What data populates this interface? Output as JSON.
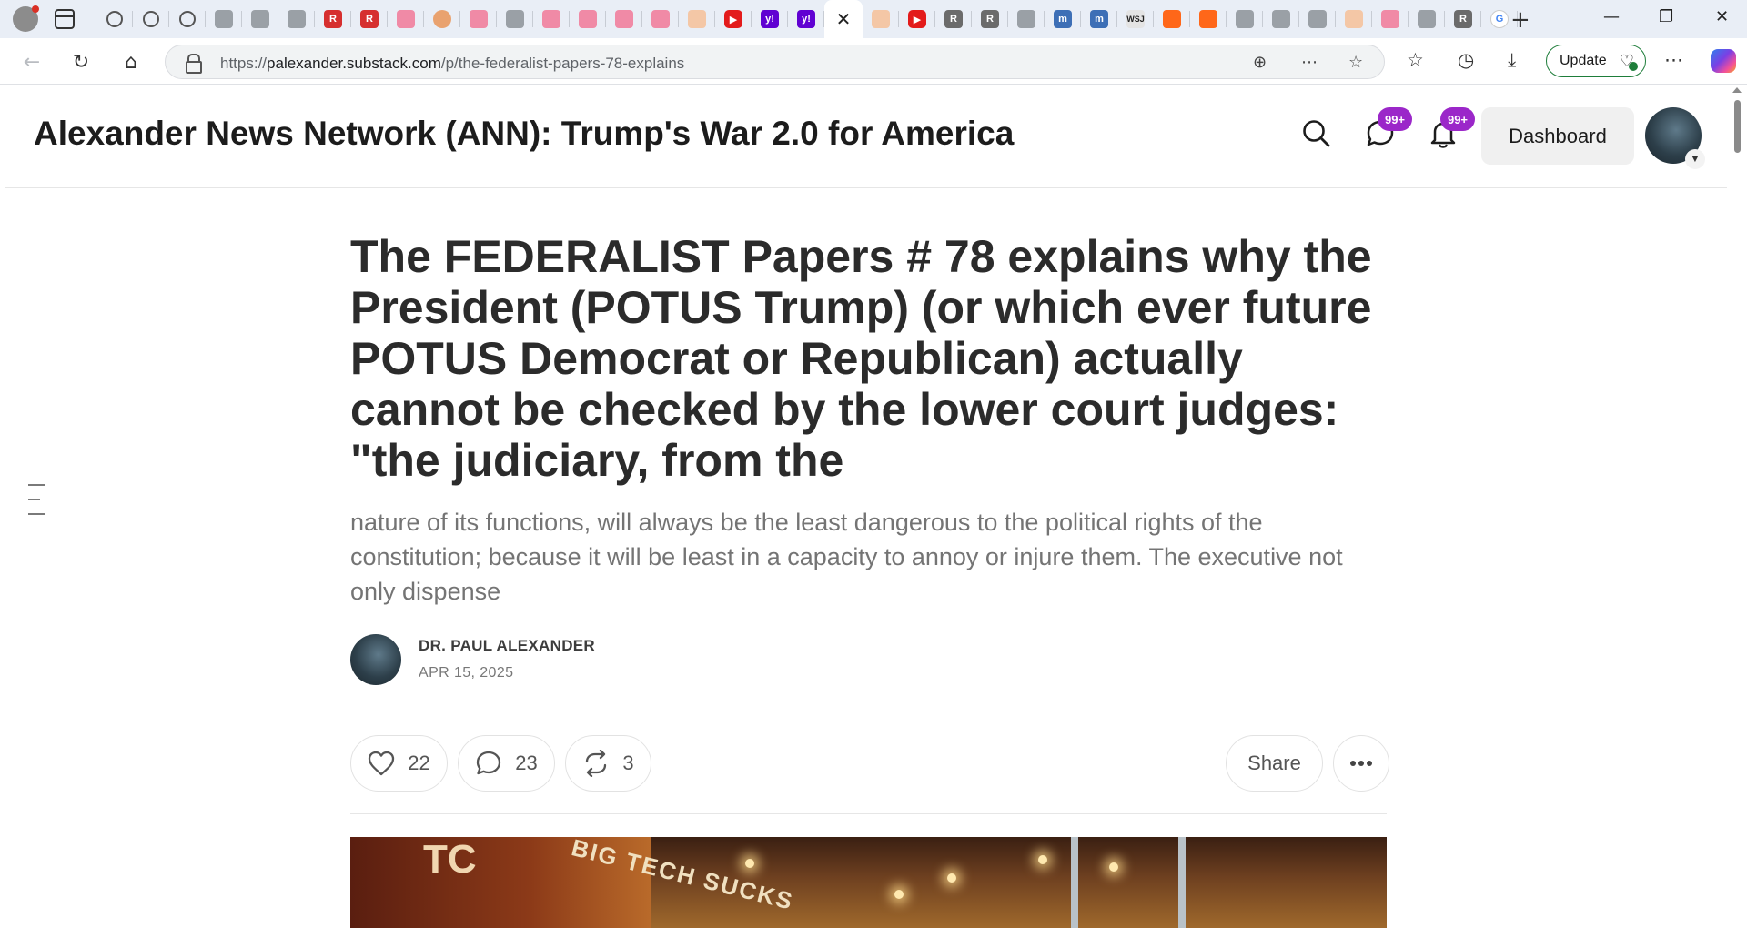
{
  "browser": {
    "url_prefix": "https://",
    "url_host": "palexander.substack.com",
    "url_path": "/p/the-federalist-papers-78-explains",
    "update_label": "Update",
    "tabs": [
      {
        "icon": "globe-icon",
        "style": "globe",
        "text": ""
      },
      {
        "icon": "globe-icon",
        "style": "globe",
        "text": ""
      },
      {
        "icon": "globe-icon",
        "style": "globe",
        "text": ""
      },
      {
        "icon": "fox-news-icon",
        "style": "gray",
        "text": ""
      },
      {
        "icon": "doc-icon",
        "style": "gray",
        "text": ""
      },
      {
        "icon": "arrow-icon",
        "style": "gray",
        "text": ""
      },
      {
        "icon": "r-icon",
        "style": "red",
        "text": "R"
      },
      {
        "icon": "r-icon",
        "style": "red",
        "text": "R"
      },
      {
        "icon": "pdf-icon",
        "style": "pink",
        "text": ""
      },
      {
        "icon": "circle-icon",
        "style": "orange",
        "text": ""
      },
      {
        "icon": "video-icon",
        "style": "pink",
        "text": ""
      },
      {
        "icon": "w-icon",
        "style": "gray",
        "text": ""
      },
      {
        "icon": "video-icon",
        "style": "pink",
        "text": ""
      },
      {
        "icon": "video-icon",
        "style": "pink",
        "text": ""
      },
      {
        "icon": "pdf-icon",
        "style": "pink",
        "text": ""
      },
      {
        "icon": "video-icon",
        "style": "pink",
        "text": ""
      },
      {
        "icon": "b-icon",
        "style": "peach",
        "text": ""
      },
      {
        "icon": "youtube-icon",
        "style": "yt",
        "text": "▶"
      },
      {
        "icon": "yahoo-icon",
        "style": "yahoo",
        "text": "y!"
      },
      {
        "icon": "yahoo-icon",
        "style": "yahoo",
        "text": "y!"
      },
      {
        "icon": "close-icon",
        "style": "active",
        "text": "✕"
      },
      {
        "icon": "substack-icon",
        "style": "peach",
        "text": ""
      },
      {
        "icon": "youtube-icon",
        "style": "yt",
        "text": "▶"
      },
      {
        "icon": "rk-icon",
        "style": "rk",
        "text": "R"
      },
      {
        "icon": "rk-icon",
        "style": "rk",
        "text": "R"
      },
      {
        "icon": "search-icon",
        "style": "gray",
        "text": ""
      },
      {
        "icon": "m-icon",
        "style": "m",
        "text": "m"
      },
      {
        "icon": "m-icon",
        "style": "m",
        "text": "m"
      },
      {
        "icon": "wsj-icon",
        "style": "wsj",
        "text": "WSJ"
      },
      {
        "icon": "substack-icon",
        "style": "ss",
        "text": ""
      },
      {
        "icon": "substack-icon",
        "style": "ss",
        "text": ""
      },
      {
        "icon": "photo-icon",
        "style": "gray",
        "text": ""
      },
      {
        "icon": "bird-icon",
        "style": "gray",
        "text": ""
      },
      {
        "icon": "chart-icon",
        "style": "gray",
        "text": ""
      },
      {
        "icon": "b-icon",
        "style": "peach",
        "text": ""
      },
      {
        "icon": "video-icon",
        "style": "pink",
        "text": ""
      },
      {
        "icon": "photo-icon",
        "style": "gray",
        "text": ""
      },
      {
        "icon": "rk-icon",
        "style": "rk",
        "text": "R"
      },
      {
        "icon": "google-icon",
        "style": "g",
        "text": "G"
      }
    ]
  },
  "site": {
    "title": "Alexander News Network (ANN): Trump's War 2.0 for America",
    "chat_badge": "99+",
    "notif_badge": "99+",
    "dashboard_label": "Dashboard"
  },
  "post": {
    "title": "The FEDERALIST Papers # 78 explains why the President (POTUS Trump) (or which ever future POTUS Democrat or Republican) actually cannot be checked by the lower court judges: \"the judiciary, from the",
    "subtitle": "nature of its functions, will always be the least dangerous to the political rights of the constitution; because it will be least in a capacity to annoy or injure them. The executive not only dispense",
    "author": "DR. PAUL ALEXANDER",
    "date": "APR 15, 2025",
    "likes": "22",
    "comments": "23",
    "restacks": "3",
    "share_label": "Share"
  },
  "hero_image": {
    "sign_text": "BIG TECH SUCKS"
  }
}
